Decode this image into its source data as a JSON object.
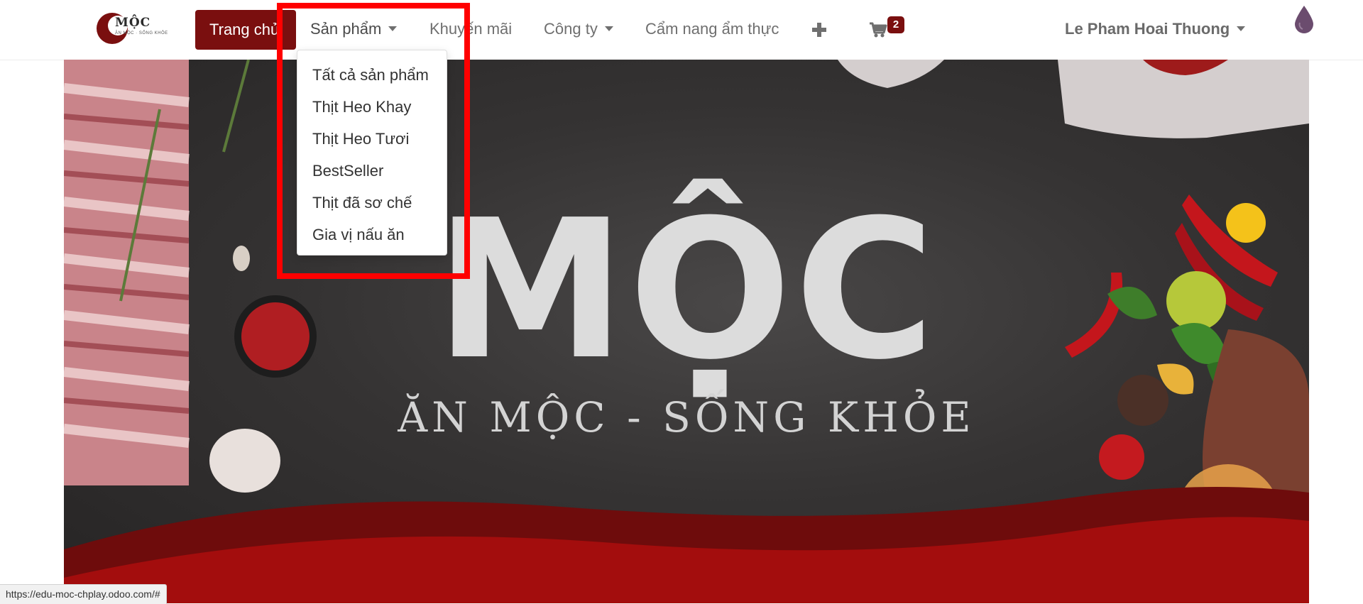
{
  "brand": {
    "logo_text": "MỘC",
    "logo_sub": "ĂN MỘC · SỐNG KHỎE",
    "accent_color": "#7a0f0f"
  },
  "nav": {
    "home": "Trang chủ",
    "products": "Sản phẩm",
    "promotions": "Khuyến mãi",
    "company": "Công ty",
    "cookbook": "Cẩm nang ẩm thực",
    "plus_icon": "plus-icon",
    "cart_icon": "cart-icon",
    "cart_count": "2",
    "user": "Le Pham Hoai Thuong"
  },
  "products_menu": {
    "items": [
      "Tất cả sản phẩm",
      "Thịt Heo Khay",
      "Thịt Heo Tươi",
      "BestSeller",
      "Thịt đã sơ chế",
      "Gia vị nấu ăn"
    ],
    "highlight_color": "#ff0000"
  },
  "hero": {
    "title": "MỘC",
    "tagline": "ĂN MỘC - SỐNG KHỎE"
  },
  "status_bar": {
    "url": "https://edu-moc-chplay.odoo.com/#"
  }
}
